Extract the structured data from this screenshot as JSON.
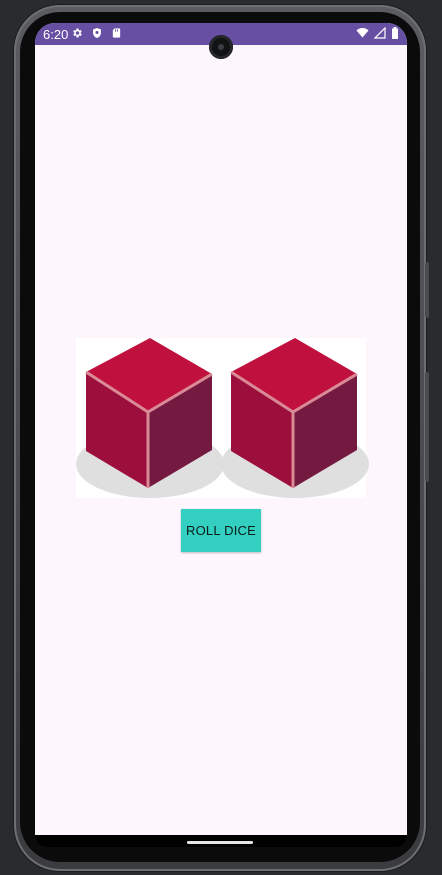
{
  "status_bar": {
    "time": "6:20",
    "background_color": "#6750a4",
    "left_icons": [
      "settings-icon",
      "shield-icon",
      "sd-card-icon"
    ],
    "right_icons": [
      "wifi-icon",
      "cell-signal-icon",
      "battery-icon"
    ]
  },
  "app": {
    "background_color": "#fdf6fd",
    "dice": [
      {
        "name": "die-1",
        "icon": "dice-cube"
      },
      {
        "name": "die-2",
        "icon": "dice-cube"
      }
    ],
    "roll_button_label": "ROLL DICE",
    "roll_button_color": "#33cfc0"
  }
}
